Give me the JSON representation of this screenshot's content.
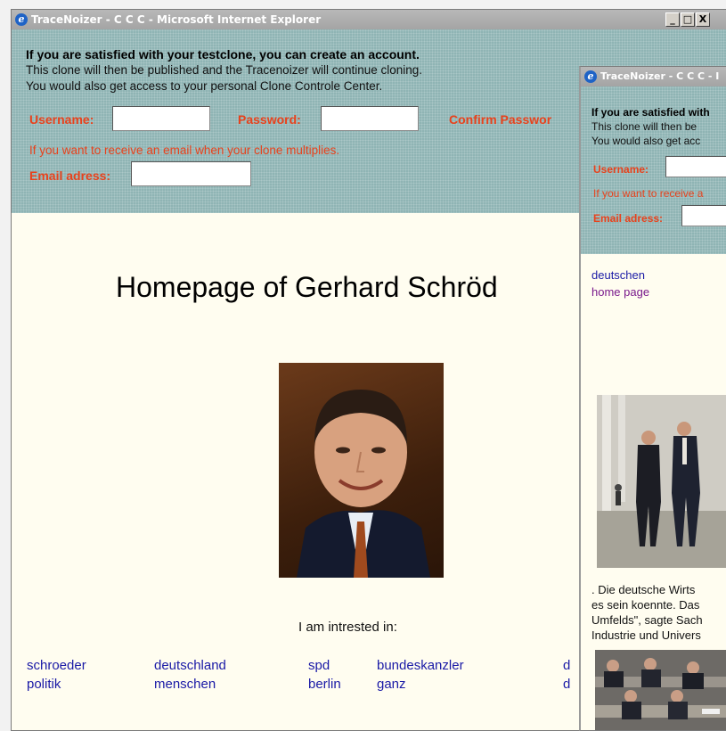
{
  "main_window": {
    "title": "TraceNoizer - C C C - Microsoft Internet Explorer",
    "controls": {
      "minimize": "_",
      "maximize": "□",
      "close": "X"
    },
    "banner": {
      "headline": "If you are satisfied with your testclone, you can create an account.",
      "line2": "This clone will then be published and the Tracenoizer will continue cloning.",
      "line3": "You would also get access to your personal Clone Controle Center.",
      "username_label": "Username:",
      "password_label": "Password:",
      "confirm_label": "Confirm Passwor",
      "email_note": "If you want to receive an email when your clone multiplies.",
      "email_label": "Email adress:"
    },
    "page": {
      "title": "Homepage of Gerhard Schröd",
      "interests_label": "I am intrested in:",
      "links_row1": [
        "schroeder",
        "deutschland",
        "spd",
        "bundeskanzler",
        "d"
      ],
      "links_row2": [
        "politik",
        "menschen",
        "berlin",
        "ganz",
        "d"
      ]
    }
  },
  "second_window": {
    "title": "TraceNoizer - C C C - I",
    "banner": {
      "headline": "If you are satisfied with",
      "line2": "This clone will then be",
      "line3": "You would also get acc",
      "username_label": "Username:",
      "email_note": "If you want to receive a",
      "email_label": "Email adress:"
    },
    "page": {
      "link1": "deutschen",
      "link2": "home page",
      "caption_lines": [
        ". Die deutsche Wirts",
        "es sein koennte. Das",
        "Umfelds\", sagte Sach",
        "Industrie und Univers"
      ]
    }
  },
  "colors": {
    "banner_bg": "#8fb4b4",
    "label_red": "#e8421c",
    "link_blue": "#1a1aa6",
    "visited_purple": "#7a1a8c",
    "page_bg": "#fffdf0"
  }
}
